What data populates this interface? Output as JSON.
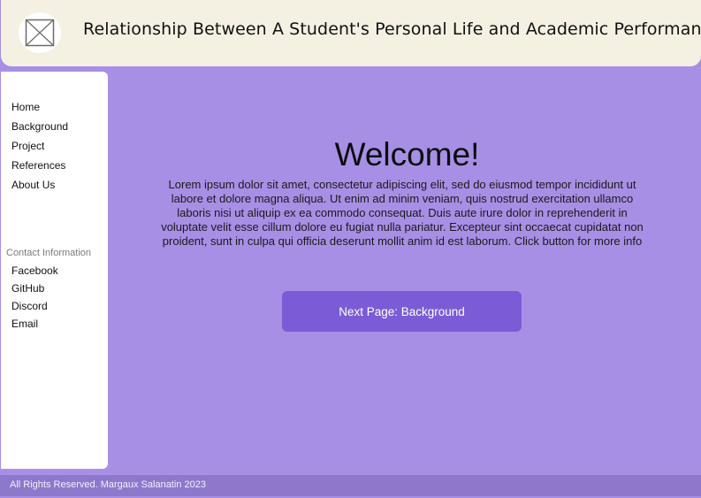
{
  "header": {
    "title": "Relationship Between A Student's Personal Life and Academic Performance",
    "logo_icon": "image-placeholder-icon"
  },
  "sidebar": {
    "nav_items": [
      {
        "label": "Home"
      },
      {
        "label": "Background"
      },
      {
        "label": "Project"
      },
      {
        "label": "References"
      },
      {
        "label": "About Us"
      }
    ],
    "contact_heading": "Contact Information",
    "contact_items": [
      {
        "label": "Facebook"
      },
      {
        "label": "GitHub"
      },
      {
        "label": "Discord"
      },
      {
        "label": "Email"
      }
    ]
  },
  "main": {
    "heading": "Welcome!",
    "body": "Lorem ipsum dolor sit amet, consectetur adipiscing elit, sed do eiusmod tempor incididunt ut labore et dolore magna aliqua. Ut enim ad minim veniam, quis nostrud exercitation ullamco laboris nisi ut aliquip ex ea commodo consequat. Duis aute irure dolor in reprehenderit in voluptate velit esse cillum dolore eu fugiat nulla pariatur. Excepteur sint occaecat cupidatat non proident, sunt in culpa qui officia deserunt mollit anim id est laborum. Click button for more info",
    "next_button_label": "Next Page: Background"
  },
  "footer": {
    "text": "All Rights Reserved. Margaux Salanatin 2023"
  },
  "colors": {
    "page_background": "#a78fe5",
    "header_background": "#f4f1e2",
    "button_background": "#7b5cd6",
    "footer_background": "#8e78cc"
  }
}
